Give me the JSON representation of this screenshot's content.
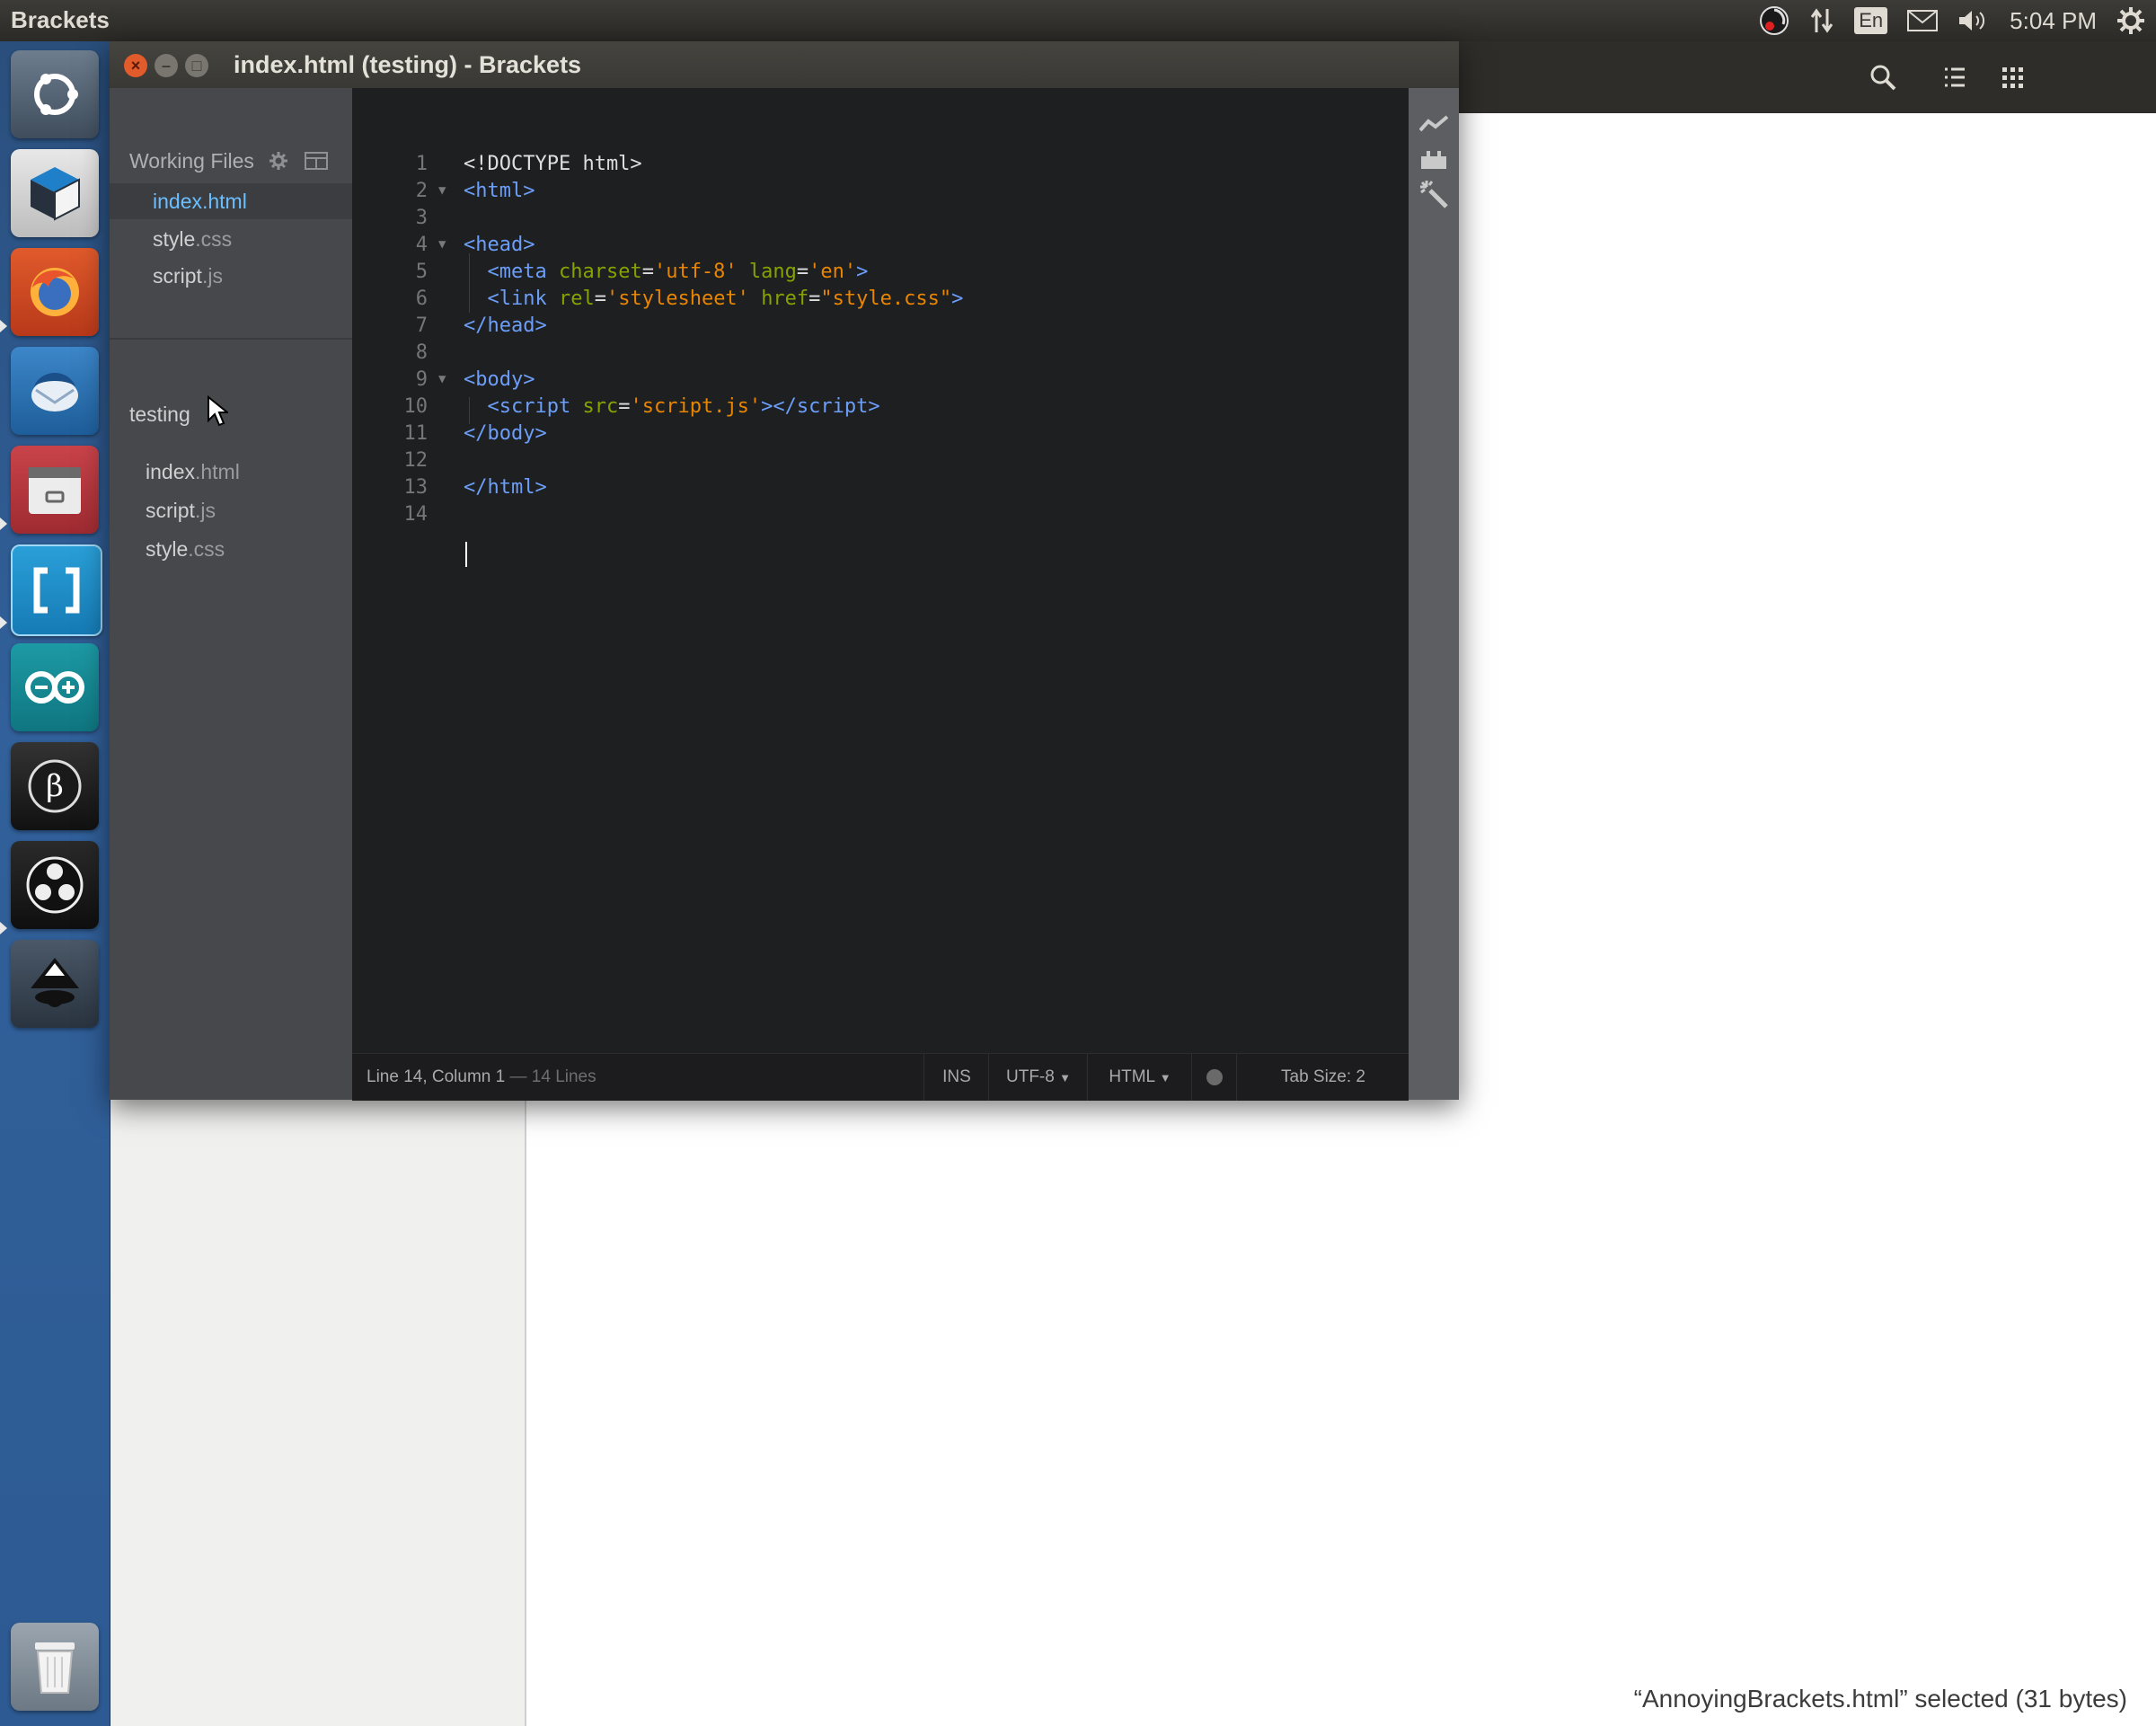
{
  "top_panel": {
    "app_title": "Brackets",
    "indicators": {
      "keyboard_layout": "En",
      "clock": "5:04 PM"
    }
  },
  "launcher": {
    "items": [
      {
        "name": "ubuntu-dash-icon"
      },
      {
        "name": "cube-app-icon"
      },
      {
        "name": "firefox-icon"
      },
      {
        "name": "thunderbird-icon"
      },
      {
        "name": "file-manager-icon"
      },
      {
        "name": "brackets-app-icon"
      },
      {
        "name": "arduino-icon"
      },
      {
        "name": "p3-app-icon"
      },
      {
        "name": "obs-icon"
      },
      {
        "name": "inkscape-icon"
      },
      {
        "name": "trash-icon"
      }
    ]
  },
  "window": {
    "title": "index.html (testing) - Brackets",
    "close": "×",
    "minimize": "–",
    "maximize": "□"
  },
  "sidebar": {
    "working_files_label": "Working Files",
    "working_files": [
      {
        "name": "index",
        "ext": ".html",
        "active": true
      },
      {
        "name": "style",
        "ext": ".css",
        "active": false
      },
      {
        "name": "script",
        "ext": ".js",
        "active": false
      }
    ],
    "project_name": "testing",
    "project_files": [
      {
        "name": "index",
        "ext": ".html"
      },
      {
        "name": "script",
        "ext": ".js"
      },
      {
        "name": "style",
        "ext": ".css"
      }
    ]
  },
  "editor": {
    "line_numbers": [
      "1",
      "2",
      "3",
      "4",
      "5",
      "6",
      "7",
      "8",
      "9",
      "10",
      "11",
      "12",
      "13",
      "14"
    ]
  },
  "status_bar": {
    "cursor_position": "Line 14, Column 1",
    "line_count": " — 14 Lines",
    "mode": "INS",
    "encoding": "UTF-8",
    "language": "HTML",
    "tab_size": "Tab Size:  2"
  },
  "file_manager": {
    "status": "“AnnoyingBrackets.html” selected  (31 bytes)"
  }
}
